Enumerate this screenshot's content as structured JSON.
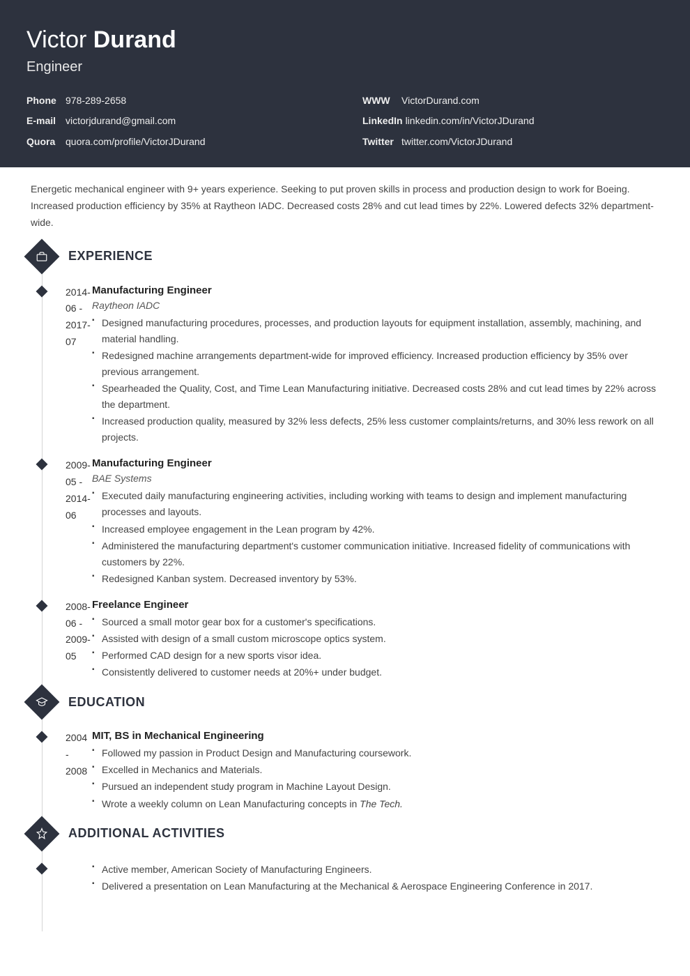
{
  "name_first": "Victor",
  "name_last": "Durand",
  "title": "Engineer",
  "contacts_left": [
    {
      "label": "Phone",
      "value": "978-289-2658"
    },
    {
      "label": "E-mail",
      "value": "victorjdurand@gmail.com"
    },
    {
      "label": "Quora",
      "value": "quora.com/profile/VictorJDurand"
    }
  ],
  "contacts_right": [
    {
      "label": "WWW",
      "value": "VictorDurand.com"
    },
    {
      "label": "LinkedIn",
      "value": "linkedin.com/in/VictorJDurand"
    },
    {
      "label": "Twitter",
      "value": "twitter.com/VictorJDurand"
    }
  ],
  "summary": "Energetic mechanical engineer with 9+ years experience. Seeking to put proven skills in process and production design to work for Boeing. Increased production efficiency by 35% at Raytheon IADC. Decreased costs 28% and cut lead times by 22%. Lowered defects 32% department-wide.",
  "sections": {
    "experience": {
      "heading": "EXPERIENCE",
      "items": [
        {
          "dates": "2014-06 - 2017-07",
          "title": "Manufacturing Engineer",
          "subtitle": "Raytheon IADC",
          "bullets": [
            "Designed manufacturing procedures, processes, and production layouts for equipment installation, assembly, machining, and material handling.",
            "Redesigned machine arrangements department-wide for improved efficiency. Increased production efficiency by 35% over previous arrangement.",
            "Spearheaded the Quality, Cost, and Time Lean Manufacturing initiative. Decreased costs 28% and cut lead times by 22% across the department.",
            "Increased production quality, measured by 32% less defects, 25% less customer complaints/returns, and 30% less rework on all projects."
          ]
        },
        {
          "dates": "2009-05 - 2014-06",
          "title": "Manufacturing Engineer",
          "subtitle": "BAE Systems",
          "bullets": [
            "Executed daily manufacturing engineering activities, including working with teams to design and implement manufacturing processes and layouts.",
            "Increased employee engagement in the Lean program by 42%.",
            "Administered the manufacturing department's customer communication initiative. Increased fidelity of communications with customers by 22%.",
            "Redesigned Kanban system. Decreased inventory by 53%."
          ]
        },
        {
          "dates": "2008-06 - 2009-05",
          "title": "Freelance Engineer",
          "subtitle": "",
          "bullets": [
            "Sourced a small motor gear box for a customer's specifications.",
            "Assisted with design of a small custom microscope optics system.",
            "Performed CAD design for a new sports visor idea.",
            "Consistently delivered to customer needs at 20%+ under budget."
          ]
        }
      ]
    },
    "education": {
      "heading": "EDUCATION",
      "items": [
        {
          "dates": "2004 - 2008",
          "title": "MIT, BS in Mechanical Engineering",
          "subtitle": "",
          "bullets_html": [
            "Followed my passion in Product Design and Manufacturing coursework.",
            "Excelled in Mechanics and Materials.",
            "Pursued an independent study program in Machine Layout Design.",
            "Wrote a weekly column on Lean Manufacturing concepts in <span class=\"italic-inline\">The Tech.</span>"
          ]
        }
      ]
    },
    "activities": {
      "heading": "ADDITIONAL ACTIVITIES",
      "items": [
        {
          "dates": "",
          "title": "",
          "subtitle": "",
          "bullets": [
            "Active member, American Society of Manufacturing Engineers.",
            "Delivered a presentation on Lean Manufacturing at the Mechanical & Aerospace Engineering Conference in 2017."
          ]
        }
      ]
    }
  }
}
